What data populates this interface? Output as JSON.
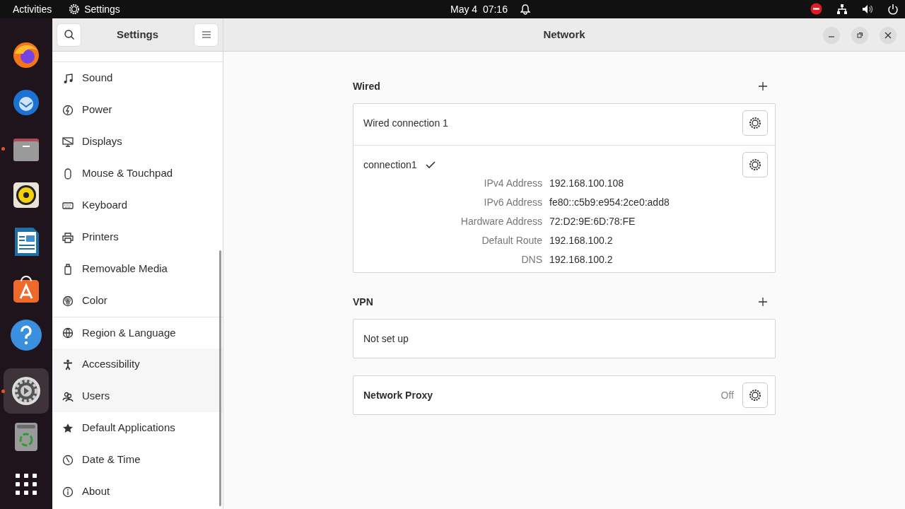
{
  "top_bar": {
    "activities": "Activities",
    "app_name": "Settings",
    "clock": "May 4  07:16"
  },
  "dock": [
    {
      "running": false,
      "selected": false
    },
    {
      "running": false,
      "selected": false
    },
    {
      "running": true,
      "selected": false
    },
    {
      "running": false,
      "selected": false
    },
    {
      "running": false,
      "selected": false
    },
    {
      "running": false,
      "selected": false
    },
    {
      "running": false,
      "selected": false
    },
    {
      "running": true,
      "selected": true
    },
    {
      "running": false,
      "selected": false
    }
  ],
  "sidebar": {
    "title": "Settings",
    "items": [
      {
        "label": "Sound"
      },
      {
        "label": "Power"
      },
      {
        "label": "Displays"
      },
      {
        "label": "Mouse & Touchpad"
      },
      {
        "label": "Keyboard"
      },
      {
        "label": "Printers"
      },
      {
        "label": "Removable Media"
      },
      {
        "label": "Color"
      },
      {
        "label": "Region & Language"
      },
      {
        "label": "Accessibility"
      },
      {
        "label": "Users"
      },
      {
        "label": "Default Applications"
      },
      {
        "label": "Date & Time"
      },
      {
        "label": "About"
      }
    ]
  },
  "window": {
    "title": "Network"
  },
  "wired": {
    "heading": "Wired",
    "connections": [
      {
        "name": "Wired connection 1",
        "active": false
      },
      {
        "name": "connection1",
        "active": true,
        "details": [
          {
            "label": "IPv4 Address",
            "value": "192.168.100.108"
          },
          {
            "label": "IPv6 Address",
            "value": "fe80::c5b9:e954:2ce0:add8"
          },
          {
            "label": "Hardware Address",
            "value": "72:D2:9E:6D:78:FE"
          },
          {
            "label": "Default Route",
            "value": "192.168.100.2"
          },
          {
            "label": "DNS",
            "value": "192.168.100.2"
          }
        ]
      }
    ]
  },
  "vpn": {
    "heading": "VPN",
    "empty_text": "Not set up"
  },
  "proxy": {
    "label": "Network Proxy",
    "status": "Off"
  }
}
